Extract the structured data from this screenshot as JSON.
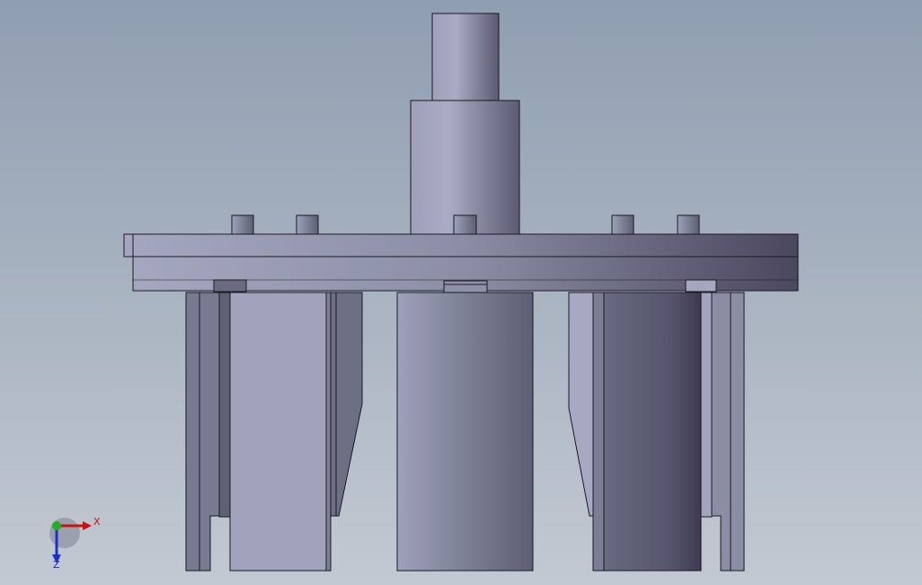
{
  "view": {
    "colors": {
      "outline": "#1a1a22",
      "part_light": "#a7aac2",
      "part_mid": "#7f8398",
      "part_dark": "#4a4760"
    }
  },
  "triad": {
    "x_label": "X",
    "z_label": "Z",
    "x_color": "#cc1111",
    "z_color": "#1a2fd0",
    "y_color": "#22b022"
  }
}
